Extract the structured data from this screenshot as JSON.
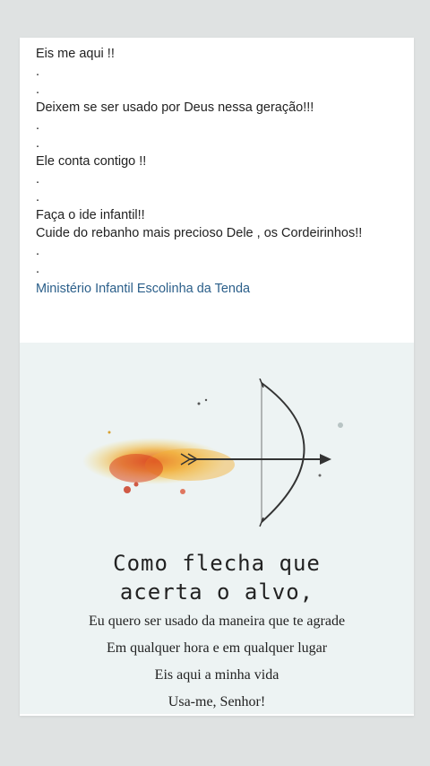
{
  "post": {
    "lines": [
      "Eis me aqui !!",
      ".",
      ".",
      "Deixem se ser usado por Deus nessa geração!!!",
      ".",
      ".",
      "Ele conta contigo !!",
      ".",
      ".",
      "Faça o ide infantil!!",
      "Cuide do rebanho mais precioso Dele , os Cordeirinhos!!",
      ".",
      "."
    ],
    "link_text": "Ministério Infantil Escolinha da Tenda"
  },
  "image": {
    "headline_1": "Como flecha que",
    "headline_2": "acerta o alvo,",
    "verse_1": "Eu quero ser usado da maneira que te agrade",
    "verse_2": "Em qualquer hora e em qualquer lugar",
    "verse_3": "Eis aqui a minha vida",
    "verse_4": "Usa-me, Senhor!",
    "art": "bow-and-arrow-watercolor"
  },
  "colors": {
    "background": "#dfe2e2",
    "card": "#ffffff",
    "link": "#2b5f8a",
    "image_bg": "#edf3f3"
  }
}
